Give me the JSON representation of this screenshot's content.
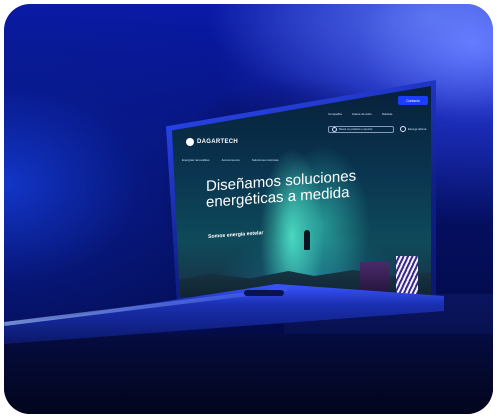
{
  "website": {
    "logo": "DAGARTECH",
    "nav_top": [
      "Compañía",
      "Casos de éxito",
      "Noticias"
    ],
    "contact_button": "Contacto",
    "search_placeholder": "Busca un producto o servicio",
    "language": "Escoge idioma",
    "menu": [
      "Energías renovables",
      "Autoconsumo",
      "Soluciones técnicas"
    ],
    "headline_line1": "Diseñamos soluciones",
    "headline_line2": "energéticas a medida",
    "subheadline": "Somos energía estelar"
  },
  "colors": {
    "background_blue": "#0a1aa8",
    "accent_button": "#1a3dff"
  }
}
